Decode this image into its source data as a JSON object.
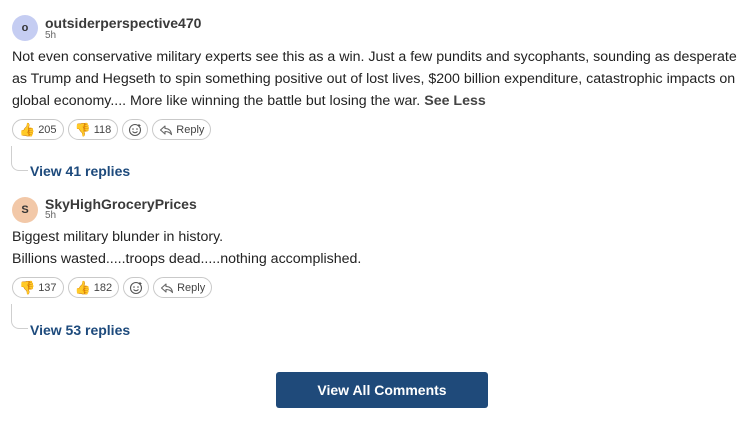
{
  "comments": [
    {
      "avatar_letter": "o",
      "avatar_color": "#c5cdf2",
      "username": "outsiderperspective470",
      "time": "5h",
      "lines": [
        "Not even conservative military experts see this as a win. Just a few pundits and sycophants, sounding as desperate as Trump and Hegseth to spin something positive out of lost lives, $200 billion expenditure, catastrophic impacts on global economy.... More like winning the battle but losing the war."
      ],
      "see_less": "See Less",
      "reaction_1": {
        "icon": "thumbs-up-icon",
        "count": "205"
      },
      "reaction_2": {
        "icon": "thumbs-down-icon",
        "count": "118"
      },
      "reply_label": "Reply",
      "view_replies": "View 41 replies"
    },
    {
      "avatar_letter": "S",
      "avatar_color": "#f2c8a8",
      "username": "SkyHighGroceryPrices",
      "time": "5h",
      "lines": [
        "Biggest military blunder in history.",
        "Billions wasted.....troops dead.....nothing accomplished."
      ],
      "reaction_1": {
        "icon": "thumbs-down-icon",
        "count": "137"
      },
      "reaction_2": {
        "icon": "thumbs-up-icon",
        "count": "182"
      },
      "reply_label": "Reply",
      "view_replies": "View 53 replies"
    }
  ],
  "view_all_label": "View All Comments",
  "colors": {
    "link": "#1d4a7c",
    "button_bg": "#1f4a7a"
  }
}
